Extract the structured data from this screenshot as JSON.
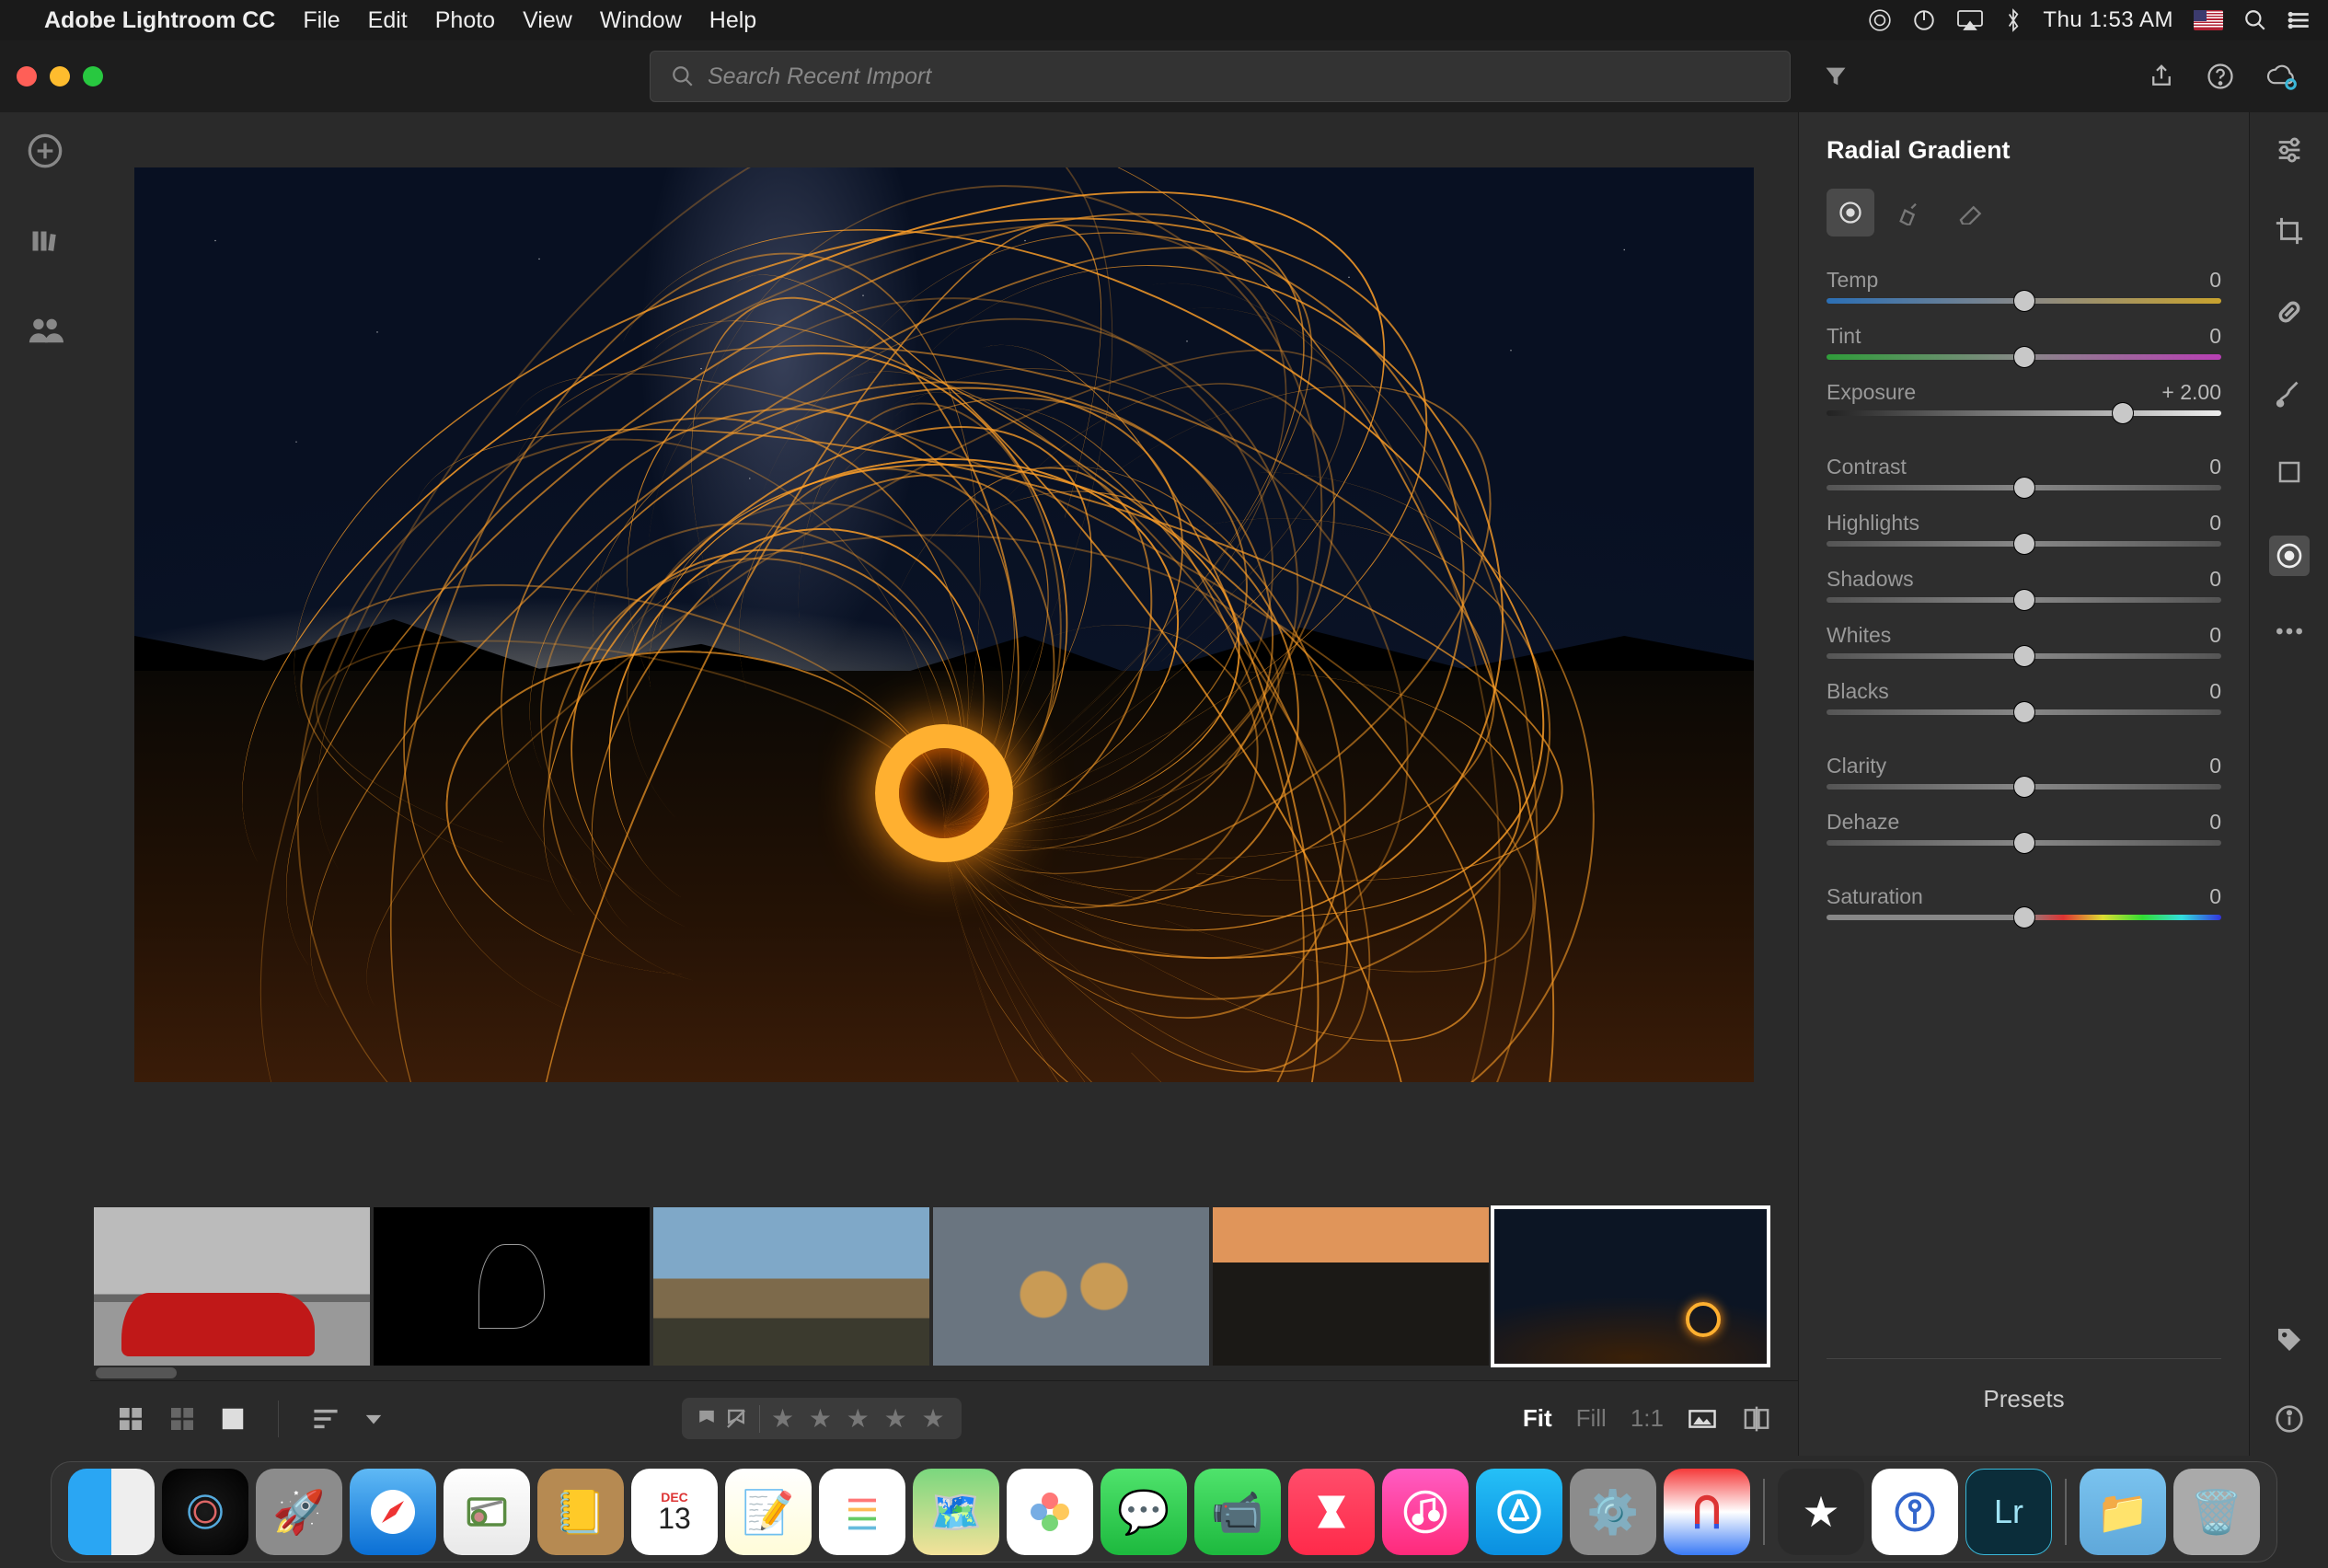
{
  "menubar": {
    "app_name": "Adobe Lightroom CC",
    "menus": [
      "File",
      "Edit",
      "Photo",
      "View",
      "Window",
      "Help"
    ],
    "clock": "Thu 1:53 AM"
  },
  "toolbar": {
    "search_placeholder": "Search Recent Import"
  },
  "left_sidebar": {
    "icons": [
      "add",
      "library",
      "people"
    ]
  },
  "filmstrip": {
    "thumbs": [
      "red-sports-car",
      "apple-outline",
      "mountain-landscape",
      "coffee-cups",
      "sunset-rocks",
      "steel-wool-spin"
    ],
    "selected_index": 5
  },
  "bottom": {
    "fit": "Fit",
    "fill": "Fill",
    "one_to_one": "1:1",
    "stars": 5,
    "presets_label": "Presets"
  },
  "panel": {
    "title": "Radial Gradient",
    "brush_tools": [
      "new",
      "brush",
      "eraser"
    ],
    "sliders": [
      {
        "label": "Temp",
        "value": "0",
        "pos": 50,
        "track": "tr-temp"
      },
      {
        "label": "Tint",
        "value": "0",
        "pos": 50,
        "track": "tr-tint"
      },
      {
        "label": "Exposure",
        "value": "+ 2.00",
        "pos": 75,
        "track": "tr-exp"
      },
      {
        "label": "Contrast",
        "value": "0",
        "pos": 50,
        "track": "tr-gray"
      },
      {
        "label": "Highlights",
        "value": "0",
        "pos": 50,
        "track": "tr-gray"
      },
      {
        "label": "Shadows",
        "value": "0",
        "pos": 50,
        "track": "tr-gray"
      },
      {
        "label": "Whites",
        "value": "0",
        "pos": 50,
        "track": "tr-gray"
      },
      {
        "label": "Blacks",
        "value": "0",
        "pos": 50,
        "track": "tr-gray"
      },
      {
        "label": "Clarity",
        "value": "0",
        "pos": 50,
        "track": "tr-gray"
      },
      {
        "label": "Dehaze",
        "value": "0",
        "pos": 50,
        "track": "tr-gray"
      },
      {
        "label": "Saturation",
        "value": "0",
        "pos": 50,
        "track": "tr-sat"
      }
    ]
  },
  "right_tools": [
    "edit",
    "crop",
    "heal",
    "brush",
    "linear",
    "radial",
    "more",
    "tag",
    "info"
  ],
  "right_tools_selected": 5,
  "dock": {
    "cal_month": "DEC",
    "cal_day": "13",
    "lr_label": "Lr"
  }
}
